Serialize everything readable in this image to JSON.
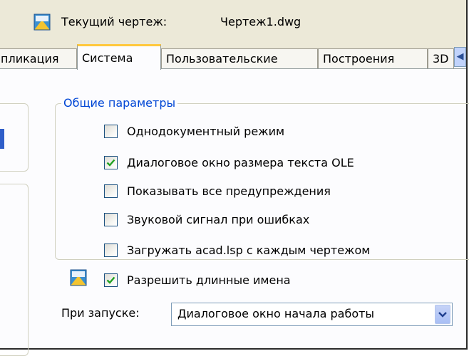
{
  "header": {
    "current_drawing_label": "Текущий чертеж:",
    "current_drawing_value": "Чертеж1.dwg",
    "icon": "drawing-file-icon"
  },
  "tabs": [
    {
      "label": "пликация",
      "active": false
    },
    {
      "label": "Система",
      "active": true
    },
    {
      "label": "Пользовательские",
      "active": false
    },
    {
      "label": "Построения",
      "active": false
    },
    {
      "label": "3D",
      "active": false
    }
  ],
  "tab_scroll_icon": "scroll-left-arrow-icon",
  "general": {
    "title": "Общие параметры",
    "options": [
      {
        "label": "Однодокументный режим",
        "checked": false
      },
      {
        "label": "Диалоговое окно размера текста OLE",
        "checked": true
      },
      {
        "label": "Показывать все предупреждения",
        "checked": false
      },
      {
        "label": "Звуковой сигнал при ошибках",
        "checked": false
      },
      {
        "label": "Загружать acad.lsp с каждым чертежом",
        "checked": false
      },
      {
        "label": "Разрешить длинные имена",
        "checked": true
      }
    ]
  },
  "startup": {
    "label": "При запуске:",
    "selected": "Диалоговое окно начала работы"
  },
  "colors": {
    "group_title": "#0046d5",
    "active_tab_accent": "#ffc83c",
    "check_green": "#21a121"
  }
}
